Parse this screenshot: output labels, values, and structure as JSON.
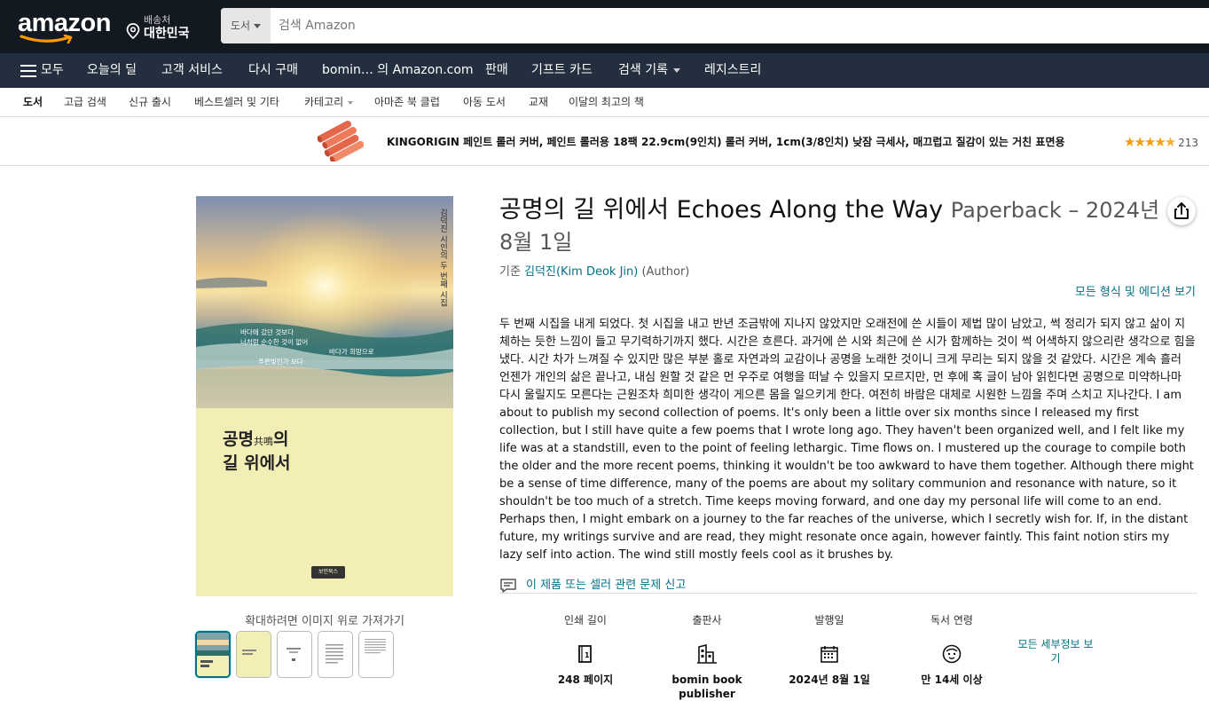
{
  "header": {
    "logo_text": "amazon",
    "deliver_label": "배송처",
    "deliver_location": "대한민국",
    "search_category": "도서",
    "search_placeholder": "검색 Amazon"
  },
  "nav": {
    "all_label": "모두",
    "items": [
      "오늘의 딜",
      "고객 서비스",
      "다시 구매",
      "bomin… 의 Amazon.com",
      "판매",
      "기프트 카드",
      "검색 기록",
      "레지스트리"
    ]
  },
  "subnav": {
    "items": [
      "도서",
      "고급 검색",
      "신규 출시",
      "베스트셀러 및 기타",
      "카테고리",
      "아마존 북 클럽",
      "아동 도서",
      "교재",
      "이달의 최고의 책"
    ]
  },
  "ad": {
    "title": "KINGORIGIN 페인트 롤러 커버, 페인트 롤러용 18팩 22.9cm(9인치) 롤러 커버, 1cm(3/8인치) 낮잠 극세사, 매끄럽고 질감이 있는 거친 표면용",
    "rating": 4.5,
    "review_count_partial": "213"
  },
  "cover": {
    "vertical_text": "김덕진 시인의 두 번째 시집",
    "poem_lines": [
      "바다에 갔던 것보다",
      "너처럼 순수한 것이 없어",
      "바다가 희망으로",
      "푸른빛인가 보다"
    ],
    "title_line1": "공명",
    "title_hanja": "共鳴",
    "title_line1_end": "의",
    "title_line2": "길 위에서",
    "publisher_mark": "보민북스"
  },
  "gallery": {
    "zoom_hint": "확대하려면 이미지 위로 가져가기",
    "thumb_count": 5
  },
  "product": {
    "title": "공명의 길 위에서 Echoes Along the Way",
    "format_date": "Paperback – 2024년 8월 1일",
    "by_prefix": "기준",
    "author": "김덕진(Kim Deok Jin)",
    "author_role": "(Author)",
    "all_formats": "모든 형식 및 에디션 보기",
    "description": "두 번째 시집을 내게 되었다. 첫 시집을 내고 반년 조금밖에 지나지 않았지만 오래전에 쓴 시들이 제법 많이 남았고, 썩 정리가 되지 않고 삶이 지체하는 듯한 느낌이 들고 무기력하기까지 했다. 시간은 흐른다. 과거에 쓴 시와 최근에 쓴 시가 함께하는 것이 썩 어색하지 않으리란 생각으로 힘을 냈다. 시간 차가 느껴질 수 있지만 많은 부분 홀로 자연과의 교감이나 공명을 노래한 것이니 크게 무리는 되지 않을 것 같았다. 시간은 계속 흘러 언젠가 개인의 삶은 끝나고, 내심 원할 것 같은 먼 우주로 여행을 떠날 수 있을지 모르지만, 먼 후에 혹 글이 남아 읽힌다면 공명으로 미약하나마 다시 울릴지도 모른다는 근원조차 희미한 생각이 게으른 몸을 일으키게 한다. 여전히 바람은 대체로 시원한 느낌을 주며 스치고 지나간다. I am about to publish my second collection of poems. It's only been a little over six months since I released my first collection, but I still have quite a few poems that I wrote long ago. They haven't been organized well, and I felt like my life was at a standstill, even to the point of feeling lethargic. Time flows on. I mustered up the courage to compile both the older and the more recent poems, thinking it wouldn't be too awkward to have them together. Although there might be a sense of time difference, many of the poems are about my solitary communion and resonance with nature, so it shouldn't be too much of a stretch. Time keeps moving forward, and one day my personal life will come to an end. Perhaps then, I might embark on a journey to the far reaches of the universe, which I secretly wish for. If, in the distant future, my writings survive and are read, they might resonate once again, however faintly. This faint notion stirs my lazy self into action. The wind still mostly feels cool as it brushes by.",
    "report_link": "이 제품 또는 셀러 관련 문제 신고"
  },
  "details": {
    "items": [
      {
        "label": "인쇄 길이",
        "value": "248 페이지",
        "icon": "book-pages-icon"
      },
      {
        "label": "출판사",
        "value": "bomin book publisher",
        "icon": "building-icon"
      },
      {
        "label": "발행일",
        "value": "2024년 8월 1일",
        "icon": "calendar-icon"
      },
      {
        "label": "독서 연령",
        "value": "만 14세 이상",
        "icon": "face-icon"
      }
    ],
    "more_link": "모든 세부정보 보기"
  },
  "colors": {
    "header_bg": "#131921",
    "nav_bg": "#232f3e",
    "link": "#007185",
    "star": "#f59e0b"
  }
}
